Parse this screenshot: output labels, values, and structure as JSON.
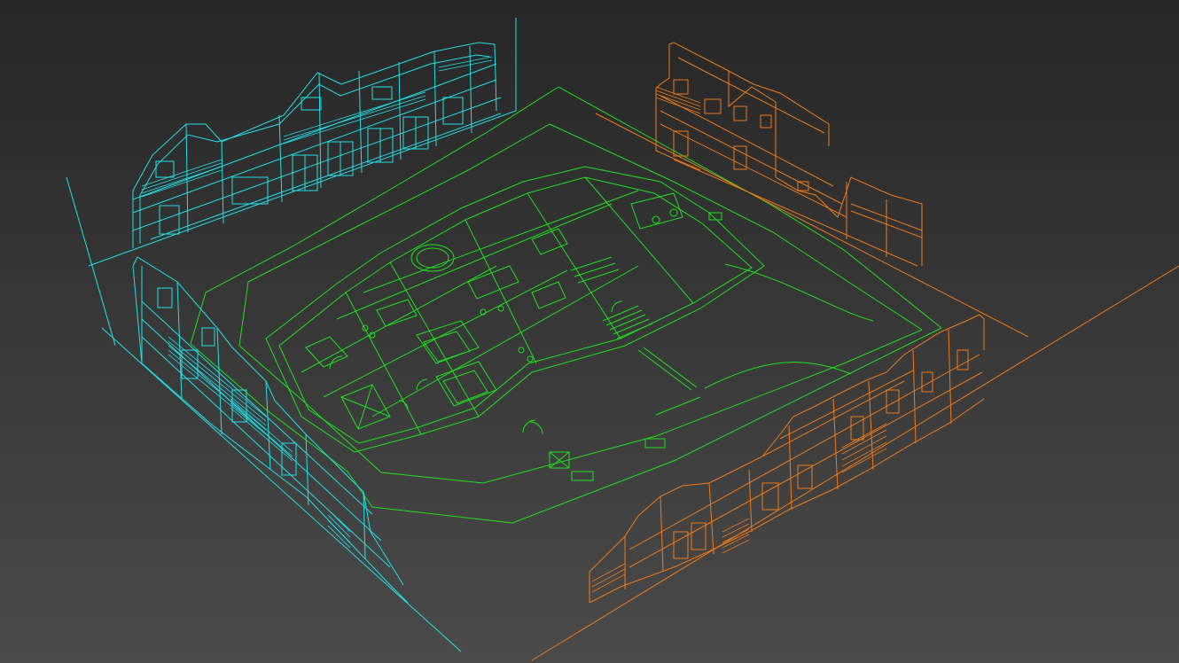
{
  "viewport": {
    "background_top": "#262626",
    "background_bottom": "#4a4a4a"
  },
  "colors": {
    "plan": "#1fe01f",
    "elevation_back_left": "#22e0e8",
    "elevation_left": "#22e0e8",
    "elevation_back_right": "#f07a18",
    "elevation_front_right": "#f07a18"
  },
  "objects": [
    {
      "id": "floor-plan",
      "label": "floor plan",
      "icon": "floor-plan-drawing"
    },
    {
      "id": "elevation-back-left",
      "label": "elevation",
      "icon": "building-elevation-drawing"
    },
    {
      "id": "elevation-left",
      "label": "elevation",
      "icon": "building-elevation-drawing"
    },
    {
      "id": "elevation-back-right",
      "label": "elevation",
      "icon": "building-elevation-drawing"
    },
    {
      "id": "elevation-front-right",
      "label": "elevation",
      "icon": "building-elevation-drawing"
    }
  ]
}
